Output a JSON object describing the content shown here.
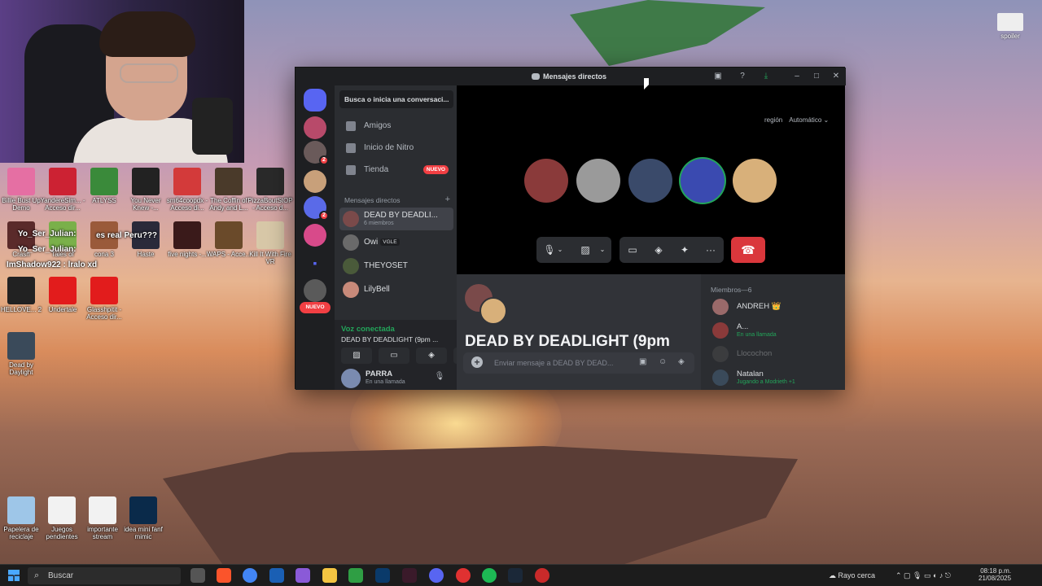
{
  "desktop": {
    "icons_top": [
      {
        "label": "Billie Bust Up Demo",
        "color": "#e56fa3"
      },
      {
        "label": "YandereSim... - Acceso dir...",
        "color": "#cc2233"
      },
      {
        "label": "ATLYSS",
        "color": "#3a8a3a"
      },
      {
        "label": "You Never Knew -...",
        "color": "#222222"
      },
      {
        "label": "sm64coopdx - Acceso di...",
        "color": "#d33a3a"
      },
      {
        "label": "The Coffin of Andy and L...",
        "color": "#4a3a2a"
      },
      {
        "label": "PizzaBoutStOP - Acceso d...",
        "color": "#2a2a2a"
      }
    ],
    "icons_row2": [
      {
        "label": "Crash",
        "color": "#5a2a2a"
      },
      {
        "label": "Tales of",
        "color": "#7ab04a"
      },
      {
        "label": "cona 3",
        "color": "#9a5a3a"
      },
      {
        "label": "Haste",
        "color": "#2a2a3a"
      },
      {
        "label": "five nights -...",
        "color": "#3a1a1a"
      },
      {
        "label": "WAPS - Acce...",
        "color": "#6a4a2a"
      },
      {
        "label": "Kill It With Fire VR",
        "color": "#d8c8a8"
      }
    ],
    "icons_row3": [
      {
        "label": "HELLOVE... 2",
        "color": "#222222"
      },
      {
        "label": "Undertale",
        "color": "#e21c1c"
      },
      {
        "label": "Glasshpitit - Acceso dir...",
        "color": "#e21c1c"
      }
    ],
    "icons_row4": [
      {
        "label": "Dead by Daylight",
        "color": "#3a4a5a"
      }
    ],
    "icons_bottom": [
      {
        "label": "Papelera de reciclaje",
        "color": "#9ec6e8"
      },
      {
        "label": "Juegos pendientes",
        "color": "#f2f2f2"
      },
      {
        "label": "importante stream",
        "color": "#f2f2f2"
      },
      {
        "label": "idea mini fanf mimic",
        "color": "#0a2a4a"
      }
    ],
    "chat_overlay": [
      "Yo_Ser_Julian:",
      "es real Peru???",
      "Yo_Ser_Julian:",
      "ImShadow922 : lralo xd"
    ],
    "spoiler_label": "spoiler"
  },
  "discord": {
    "window_title": "Mensajes directos",
    "search_placeholder": "Busca o inicia una conversaci...",
    "nav": [
      {
        "label": "Amigos"
      },
      {
        "label": "Inicio de Nitro"
      },
      {
        "label": "Tienda",
        "badge": "NUEVO"
      }
    ],
    "dm_header": "Mensajes directos",
    "dms": [
      {
        "name": "DEAD BY DEADLI...",
        "sub": "6 miembros",
        "color": "#7a4a4a",
        "active": true
      },
      {
        "name": "Owi",
        "tag": "VGLE",
        "color": "#6a6a6a"
      },
      {
        "name": "THEYOSET",
        "color": "#4a5a3a"
      },
      {
        "name": "LilyBell",
        "color": "#c88a7a"
      }
    ],
    "guild_new": "NUEVO",
    "guild_badges": [
      "2",
      "2"
    ],
    "voice": {
      "status": "Voz conectada",
      "channel": "DEAD BY DEADLIGHT (9pm ..."
    },
    "user": {
      "name": "PARRA",
      "status": "En una llamada"
    },
    "call": {
      "region_label": "región",
      "region_value": "Automático",
      "participants": [
        {
          "name": "spiderman",
          "color": "#8a3a3a"
        },
        {
          "name": "dog",
          "color": "#9a9a9a"
        },
        {
          "name": "john",
          "color": "#3a4a6a"
        },
        {
          "name": "blue",
          "color": "#3a4ab0"
        },
        {
          "name": "anime",
          "color": "#d8b07a"
        }
      ]
    },
    "chat": {
      "title": "DEAD BY DEADLIGHT (9pm",
      "input_placeholder": "Enviar mensaje a DEAD BY DEAD..."
    },
    "members": {
      "header": "Miembros—6",
      "list": [
        {
          "name": "ANDREH 👑",
          "status": "",
          "color": "#9a6a6a"
        },
        {
          "name": "A...",
          "status": "En una llamada",
          "color": "#8a3a3a"
        },
        {
          "name": "Llocochon",
          "status": "",
          "color": "#5a5a5a"
        },
        {
          "name": "Natalan",
          "status": "Jugando a Modrieth +1",
          "color": "#3a4a5a"
        }
      ]
    }
  },
  "taskbar": {
    "search_label": "Buscar",
    "weather": "Rayo cerca",
    "time": "08:18 p.m.",
    "date": "21/08/2025"
  }
}
